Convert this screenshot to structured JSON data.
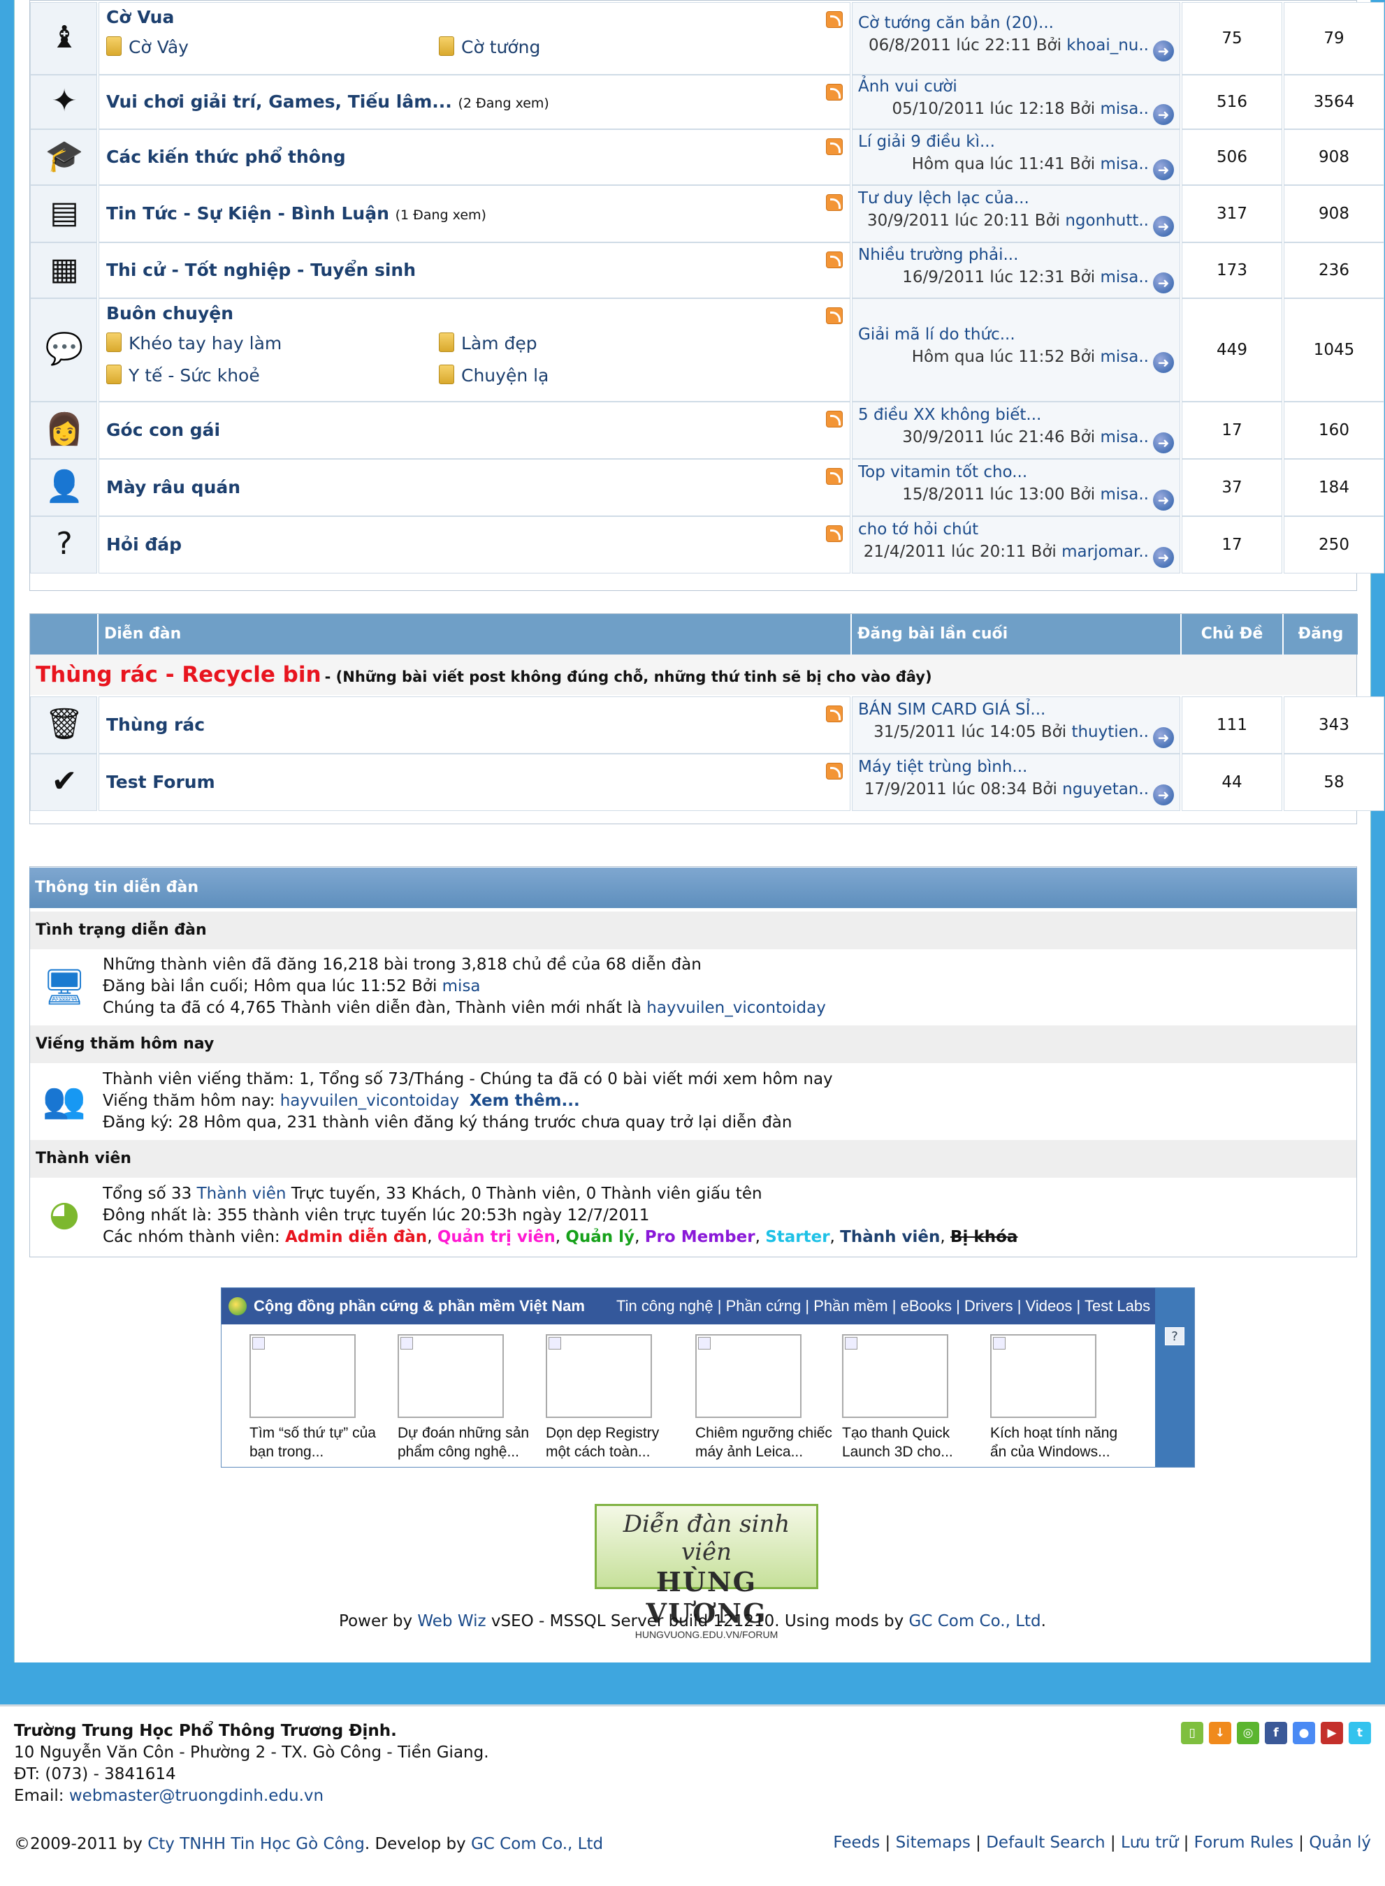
{
  "forums_top": [
    {
      "icon": "chess-icon",
      "glyph": "♝",
      "name": "Cờ Vua",
      "viewing": "",
      "subs": [
        "Cờ Vây",
        "Cờ tướng"
      ],
      "last_title": "Cờ tướng căn bản (20)...",
      "last_meta": "06/8/2011 lúc 22:11 Bởi",
      "last_user": "khoai_nu..",
      "topics": "75",
      "posts": "79"
    },
    {
      "icon": "games-icon",
      "glyph": "✦",
      "name": "Vui chơi giải trí, Games, Tiếu lâm...",
      "viewing": "(2 Đang xem)",
      "subs": [],
      "last_title": "Ảnh vui cười",
      "last_meta": "05/10/2011 lúc 12:18 Bởi",
      "last_user": "misa..",
      "topics": "516",
      "posts": "3564"
    },
    {
      "icon": "graduation-cap-icon",
      "glyph": "🎓",
      "name": "Các kiến thức phổ thông",
      "viewing": "",
      "subs": [],
      "last_title": "Lí giải 9 điều kì...",
      "last_meta": "Hôm qua lúc 11:41 Bởi",
      "last_user": "misa..",
      "topics": "506",
      "posts": "908"
    },
    {
      "icon": "news-icon",
      "glyph": "▤",
      "name": "Tin Tức - Sự Kiện - Bình Luận",
      "viewing": "(1 Đang xem)",
      "subs": [],
      "last_title": "Tư duy lệch lạc của...",
      "last_meta": "30/9/2011 lúc 20:11 Bởi",
      "last_user": "ngonhutt..",
      "topics": "317",
      "posts": "908"
    },
    {
      "icon": "building-icon",
      "glyph": "▦",
      "name": "Thi cử - Tốt nghiệp - Tuyển sinh",
      "viewing": "",
      "subs": [],
      "last_title": "Nhiều trường phải...",
      "last_meta": "16/9/2011 lúc 12:31 Bởi",
      "last_user": "misa..",
      "topics": "173",
      "posts": "236"
    },
    {
      "icon": "chat-bubble-icon",
      "glyph": "💬",
      "name": "Buôn chuyện",
      "viewing": "",
      "subs": [
        "Khéo tay hay làm",
        "Làm đẹp",
        "Y tế - Sức khoẻ",
        "Chuyện lạ"
      ],
      "last_title": "Giải mã lí do thức...",
      "last_meta": "Hôm qua lúc 11:52 Bởi",
      "last_user": "misa..",
      "topics": "449",
      "posts": "1045"
    },
    {
      "icon": "girl-icon",
      "glyph": "👩",
      "name": "Góc con gái",
      "viewing": "",
      "subs": [],
      "last_title": "5 điều XX không biết...",
      "last_meta": "30/9/2011 lúc 21:46 Bởi",
      "last_user": "misa..",
      "topics": "17",
      "posts": "160"
    },
    {
      "icon": "man-icon",
      "glyph": "👤",
      "name": "Mày râu quán",
      "viewing": "",
      "subs": [],
      "last_title": "Top vitamin tốt cho...",
      "last_meta": "15/8/2011 lúc 13:00 Bởi",
      "last_user": "misa..",
      "topics": "37",
      "posts": "184"
    },
    {
      "icon": "question-icon",
      "glyph": "?",
      "name": "Hỏi đáp",
      "viewing": "",
      "subs": [],
      "last_title": "cho tớ hỏi chút",
      "last_meta": "21/4/2011 lúc 20:11 Bởi",
      "last_user": "marjomar..",
      "topics": "17",
      "posts": "250"
    }
  ],
  "recycle": {
    "headers": {
      "forum": "Diễn đàn",
      "last": "Đăng bài lần cuối",
      "topics": "Chủ Đề",
      "posts": "Đăng Bài"
    },
    "category": "Thùng rác - Recycle bin",
    "category_note": "- (Những bài viết post không đúng chỗ, những thứ tinh sẽ bị cho vào đây)",
    "forums": [
      {
        "icon": "trash-icon",
        "glyph": "🗑",
        "name": "Thùng rác",
        "last_title": "BÁN SIM CARD GIÁ SỈ...",
        "last_meta": "31/5/2011 lúc 14:05 Bởi",
        "last_user": "thuytien..",
        "topics": "111",
        "posts": "343"
      },
      {
        "icon": "checkmark-icon",
        "glyph": "✔",
        "name": "Test Forum",
        "last_title": "Máy tiệt trùng bình...",
        "last_meta": "17/9/2011 lúc 08:34 Bởi",
        "last_user": "nguyetan..",
        "topics": "44",
        "posts": "58"
      }
    ]
  },
  "info": {
    "title": "Thông tin diễn đàn",
    "status_title": "Tình trạng diễn đàn",
    "status_l1": "Những thành viên đã đăng 16,218 bài trong 3,818 chủ đề của 68 diễn đàn",
    "status_l2": "Đăng bài lần cuối; Hôm qua lúc 11:52 Bởi",
    "status_l2_user": "misa",
    "status_l3": "Chúng ta đã có 4,765 Thành viên diễn đàn, Thành viên mới nhất là",
    "status_l3_user": "hayvuilen_vicontoiday",
    "visit_title": "Viếng thăm hôm nay",
    "visit_l1": "Thành viên viếng thăm: 1, Tổng số 73/Tháng - Chúng ta đã có 0 bài viết mới xem hôm nay",
    "visit_l2": "Viếng thăm hôm nay:",
    "visit_l2_user": "hayvuilen_vicontoiday",
    "visit_more": "Xem thêm...",
    "visit_l3": "Đăng ký: 28 Hôm qua, 231 thành viên đăng ký tháng trước chưa quay trở lại diễn đàn",
    "members_title": "Thành viên",
    "mem_l1a": "Tổng số 33",
    "mem_l1_link": "Thành viên",
    "mem_l1b": "Trực tuyến, 33 Khách, 0 Thành viên, 0 Thành viên giấu tên",
    "mem_l2": "Đông nhất là: 355 thành viên trực tuyến lúc 20:53h ngày 12/7/2011",
    "mem_l3": "Các nhóm thành viên:",
    "groups": [
      {
        "label": "Admin diễn đàn",
        "color": "#e8141e"
      },
      {
        "label": "Quản trị viên",
        "color": "#ff19d2"
      },
      {
        "label": "Quản lý",
        "color": "#16a11a"
      },
      {
        "label": "Pro Member",
        "color": "#8a18d8"
      },
      {
        "label": "Starter",
        "color": "#1ec1e6"
      },
      {
        "label": "Thành viên",
        "color": "#1c3f6e"
      },
      {
        "label": "Bị khóa",
        "color": "#111111"
      }
    ]
  },
  "widget": {
    "title": "Cộng đồng phần cứng & phần mềm Việt Nam",
    "links": [
      "Tin công nghệ",
      "Phần cứng",
      "Phần mềm",
      "eBooks",
      "Drivers",
      "Videos",
      "Test Labs"
    ],
    "help": "?",
    "items": [
      {
        "l1": "Tìm “số thứ tự” của",
        "l2": "bạn trong..."
      },
      {
        "l1": "Dự đoán những sản",
        "l2": "phẩm công nghệ..."
      },
      {
        "l1": "Dọn dẹp Registry",
        "l2": "một cách toàn..."
      },
      {
        "l1": "Chiêm ngưỡng chiếc",
        "l2": "máy ảnh Leica..."
      },
      {
        "l1": "Tạo thanh Quick",
        "l2": "Launch 3D cho..."
      },
      {
        "l1": "Kích hoạt tính năng",
        "l2": "ẩn của Windows..."
      }
    ]
  },
  "logo": {
    "l1": "Diễn đàn sinh viên",
    "l2": "HÙNG VƯƠNG",
    "l3": "HUNGVUONG.EDU.VN/FORUM"
  },
  "power": {
    "a": "Power by",
    "b": "Web Wiz",
    "c": "vSEO - MSSQL Server build 121210. Using mods by",
    "d": "GC Com Co., Ltd",
    "e": "."
  },
  "footer": {
    "school": "Trường Trung Học Phổ Thông Trương Định.",
    "address": "10 Nguyễn Văn Côn - Phường 2 - TX. Gò Công - Tiền Giang.",
    "phone": "ĐT: (073) - 3841614",
    "email_label": "Email:",
    "email": "webmaster@truongdinh.edu.vn",
    "copy_a": "©2009-2011 by",
    "copy_b": "Cty TNHH Tin Học Gò Công",
    "copy_c": ". Develop by",
    "copy_d": "GC Com Co., Ltd",
    "links": [
      "Feeds",
      "Sitemaps",
      "Default Search",
      "Lưu trữ",
      "Forum Rules",
      "Quản lý"
    ],
    "social": [
      {
        "name": "android-icon",
        "color": "#7fbf3f",
        "glyph": "▯"
      },
      {
        "name": "download-icon",
        "color": "#f08a1c",
        "glyph": "↓"
      },
      {
        "name": "chat-icon",
        "color": "#5bb52f",
        "glyph": "◎"
      },
      {
        "name": "facebook-icon",
        "color": "#3b5998",
        "glyph": "f"
      },
      {
        "name": "google-icon",
        "color": "#4a8af4",
        "glyph": "●"
      },
      {
        "name": "youtube-icon",
        "color": "#c4302b",
        "glyph": "▶"
      },
      {
        "name": "twitter-icon",
        "color": "#33c3ee",
        "glyph": "t"
      }
    ]
  }
}
